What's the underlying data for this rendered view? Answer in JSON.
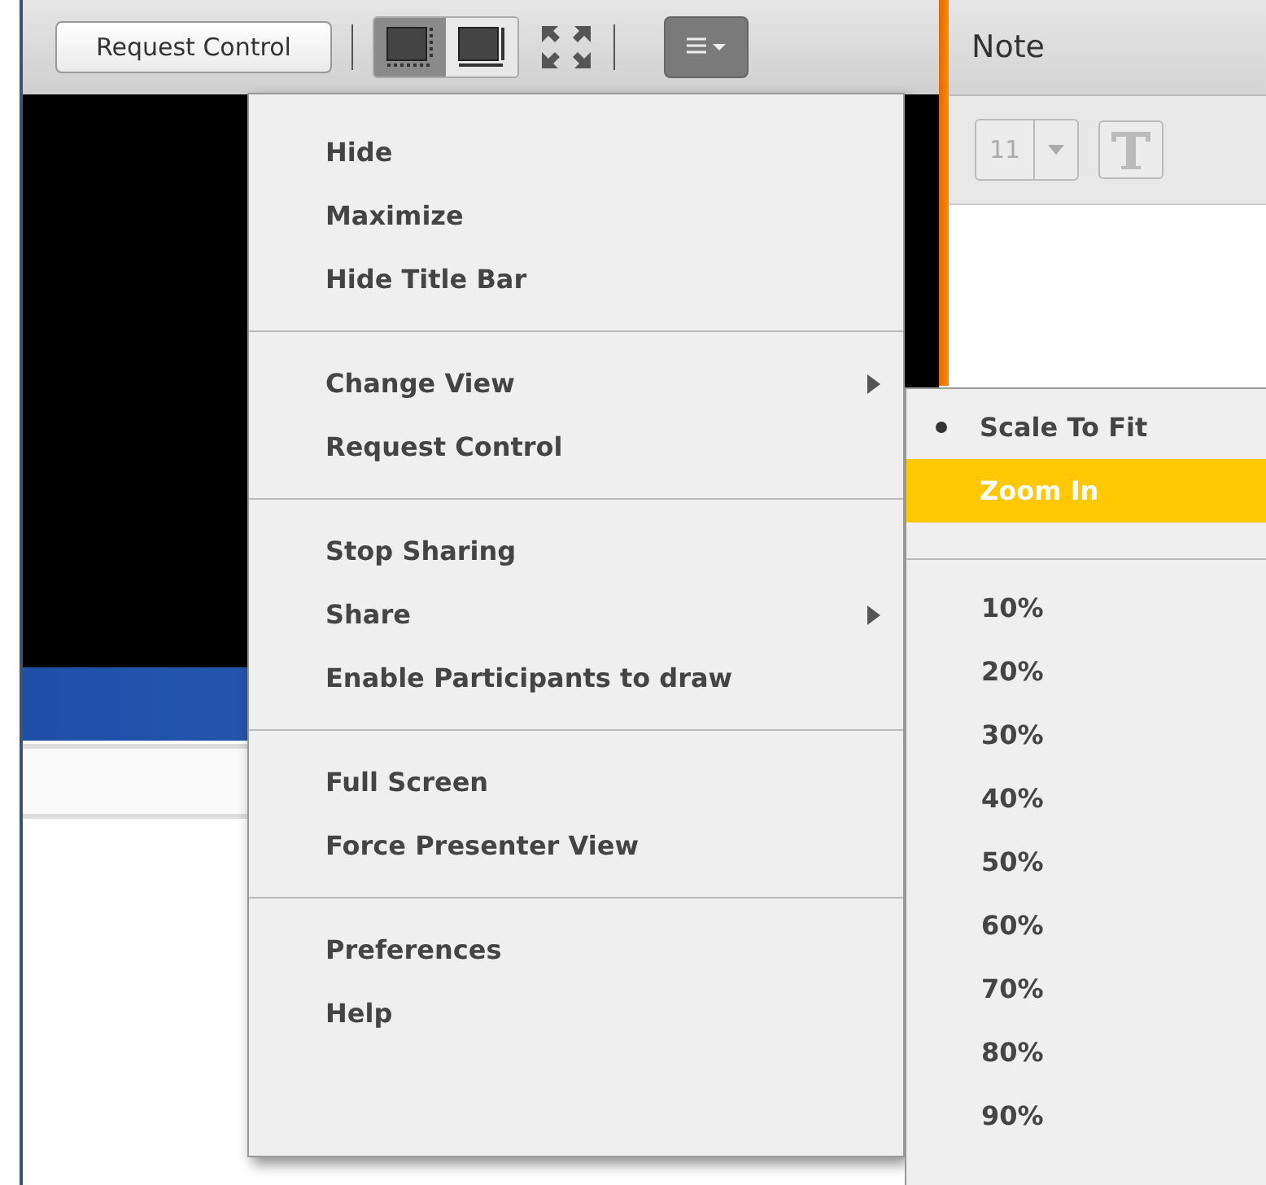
{
  "toolbar": {
    "request_button": "Request Control",
    "view_buttons": [
      {
        "selected": true
      },
      {
        "selected": false
      }
    ]
  },
  "note": {
    "title": "Note",
    "font_size": "11"
  },
  "menu": {
    "groups": [
      {
        "items": [
          {
            "label": "Hide",
            "submenu": false
          },
          {
            "label": "Maximize",
            "submenu": false
          },
          {
            "label": "Hide Title Bar",
            "submenu": false
          }
        ]
      },
      {
        "items": [
          {
            "label": "Change View",
            "submenu": true
          },
          {
            "label": "Request Control",
            "submenu": false
          }
        ]
      },
      {
        "items": [
          {
            "label": "Stop Sharing",
            "submenu": false
          },
          {
            "label": "Share",
            "submenu": true
          },
          {
            "label": "Enable Participants to draw",
            "submenu": false
          }
        ]
      },
      {
        "items": [
          {
            "label": "Full Screen",
            "submenu": false
          },
          {
            "label": "Force Presenter View",
            "submenu": false
          }
        ]
      },
      {
        "items": [
          {
            "label": "Preferences",
            "submenu": false
          },
          {
            "label": "Help",
            "submenu": false
          }
        ]
      }
    ]
  },
  "submenu": {
    "modes": [
      {
        "label": "Scale To Fit",
        "selected": true,
        "highlighted": false
      },
      {
        "label": "Zoom In",
        "selected": false,
        "highlighted": true
      }
    ],
    "zooms": [
      "10%",
      "20%",
      "30%",
      "40%",
      "50%",
      "60%",
      "70%",
      "80%",
      "90%"
    ]
  }
}
